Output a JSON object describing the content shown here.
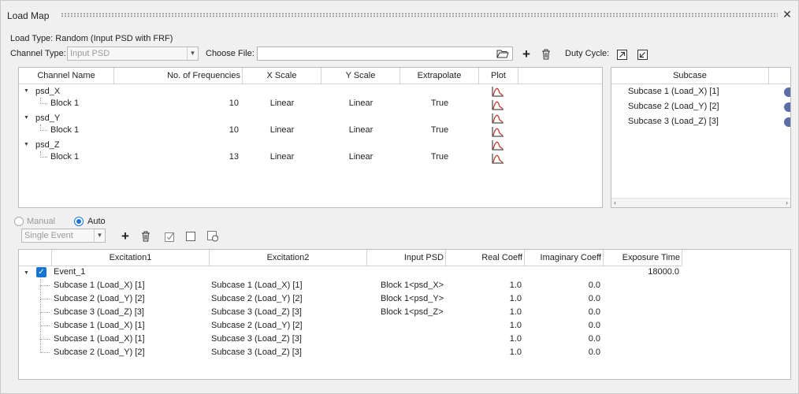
{
  "window": {
    "title": "Load Map"
  },
  "load_type": "Load Type: Random (Input PSD with FRF)",
  "channel_type": {
    "label": "Channel Type:",
    "value": "Input PSD"
  },
  "choose_file": {
    "label": "Choose File:",
    "value": ""
  },
  "duty_cycle": {
    "label": "Duty Cycle:"
  },
  "channels": {
    "headers": [
      "Channel Name",
      "No. of Frequencies",
      "X Scale",
      "Y Scale",
      "Extrapolate",
      "Plot"
    ],
    "groups": [
      {
        "name": "psd_X",
        "block": {
          "name": "Block 1",
          "freq": "10",
          "xscale": "Linear",
          "yscale": "Linear",
          "extrapolate": "True"
        }
      },
      {
        "name": "psd_Y",
        "block": {
          "name": "Block 1",
          "freq": "10",
          "xscale": "Linear",
          "yscale": "Linear",
          "extrapolate": "True"
        }
      },
      {
        "name": "psd_Z",
        "block": {
          "name": "Block 1",
          "freq": "13",
          "xscale": "Linear",
          "yscale": "Linear",
          "extrapolate": "True"
        }
      }
    ]
  },
  "subcase": {
    "header": "Subcase",
    "items": [
      "Subcase 1 (Load_X) [1]",
      "Subcase 2 (Load_Y) [2]",
      "Subcase 3 (Load_Z) [3]"
    ]
  },
  "mode": {
    "manual": "Manual",
    "auto": "Auto",
    "selected": "Auto"
  },
  "event_type": {
    "value": "Single Event"
  },
  "events": {
    "headers": [
      "Excitation1",
      "Excitation2",
      "Input PSD",
      "Real Coeff",
      "Imaginary Coeff",
      "Exposure Time"
    ],
    "event": {
      "name": "Event_1",
      "exposure": "18000.0",
      "checked": true
    },
    "rows": [
      {
        "ex1": "Subcase 1 (Load_X) [1]",
        "ex2": "Subcase 1 (Load_X) [1]",
        "psd": "Block 1<psd_X>",
        "real": "1.0",
        "imag": "0.0"
      },
      {
        "ex1": "Subcase 2 (Load_Y) [2]",
        "ex2": "Subcase 2 (Load_Y) [2]",
        "psd": "Block 1<psd_Y>",
        "real": "1.0",
        "imag": "0.0"
      },
      {
        "ex1": "Subcase 3 (Load_Z) [3]",
        "ex2": "Subcase 3 (Load_Z) [3]",
        "psd": "Block 1<psd_Z>",
        "real": "1.0",
        "imag": "0.0"
      },
      {
        "ex1": "Subcase 1 (Load_X) [1]",
        "ex2": "Subcase 2 (Load_Y) [2]",
        "psd": "",
        "real": "1.0",
        "imag": "0.0"
      },
      {
        "ex1": "Subcase 1 (Load_X) [1]",
        "ex2": "Subcase 3 (Load_Z) [3]",
        "psd": "",
        "real": "1.0",
        "imag": "0.0"
      },
      {
        "ex1": "Subcase 2 (Load_Y) [2]",
        "ex2": "Subcase 3 (Load_Z) [3]",
        "psd": "",
        "real": "1.0",
        "imag": "0.0"
      }
    ]
  },
  "colors": {
    "accent": "#1874d2",
    "plot_icon": "#c0392b"
  }
}
